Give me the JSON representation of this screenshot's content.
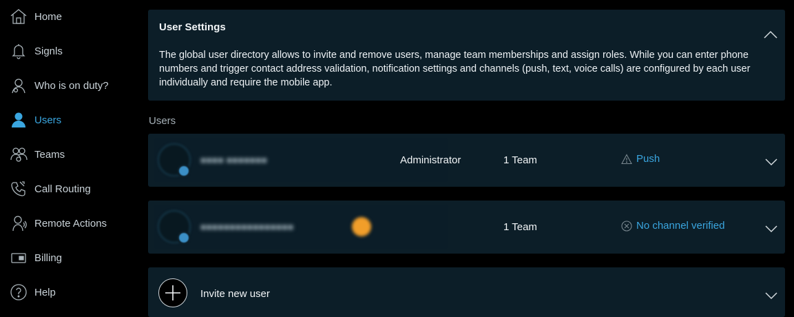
{
  "sidebar": {
    "items": [
      {
        "label": "Home",
        "icon": "home-icon"
      },
      {
        "label": "Signls",
        "icon": "bell-icon"
      },
      {
        "label": "Who is on duty?",
        "icon": "on-duty-icon"
      },
      {
        "label": "Users",
        "icon": "user-icon",
        "active": true
      },
      {
        "label": "Teams",
        "icon": "teams-icon"
      },
      {
        "label": "Call Routing",
        "icon": "phone-icon"
      },
      {
        "label": "Remote Actions",
        "icon": "remote-actions-icon"
      },
      {
        "label": "Billing",
        "icon": "billing-icon"
      },
      {
        "label": "Help",
        "icon": "help-icon"
      }
    ],
    "active_color": "#3aa6e0"
  },
  "settings": {
    "title": "User Settings",
    "description": "The global user directory allows to invite and remove users, manage team memberships and assign roles. While you can enter phone numbers and trigger contact address validation, notification settings and channels (push, text, voice calls) are configured by each user individually and require the mobile app."
  },
  "users_section": {
    "label": "Users",
    "rows": [
      {
        "role": "Administrator",
        "teams": "1 Team",
        "channel": "Push",
        "channel_icon": "warning-icon"
      },
      {
        "role": "",
        "teams": "1 Team",
        "channel": "No channel verified",
        "channel_icon": "x-circle-icon"
      }
    ]
  },
  "invite": {
    "label": "Invite new user",
    "icon": "plus-icon"
  },
  "colors": {
    "card_bg": "#0c1e28",
    "accent": "#3aa6e0",
    "background": "#000000"
  }
}
